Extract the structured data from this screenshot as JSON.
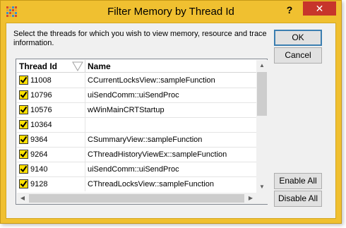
{
  "window": {
    "title": "Filter Memory by Thread Id",
    "help_label": "?",
    "close_label": "✕",
    "colors": {
      "frame": "#f0c030",
      "close": "#c7352b",
      "checkbox": "#ffe000"
    }
  },
  "instructions": "Select the threads for which you wish to view memory, resource and trace information.",
  "buttons": {
    "ok": "OK",
    "cancel": "Cancel",
    "enable_all": "Enable All",
    "disable_all": "Disable All"
  },
  "table": {
    "columns": [
      "Thread Id",
      "Name"
    ],
    "sort_icon": "sort-descending-icon",
    "rows": [
      {
        "checked": true,
        "thread_id": "11008",
        "name": "CCurrentLocksView::sampleFunction"
      },
      {
        "checked": true,
        "thread_id": "10796",
        "name": "uiSendComm::uiSendProc"
      },
      {
        "checked": true,
        "thread_id": "10576",
        "name": "wWinMainCRTStartup"
      },
      {
        "checked": true,
        "thread_id": "10364",
        "name": ""
      },
      {
        "checked": true,
        "thread_id": "9364",
        "name": "CSummaryView::sampleFunction"
      },
      {
        "checked": true,
        "thread_id": "9264",
        "name": "CThreadHistoryViewEx::sampleFunction"
      },
      {
        "checked": true,
        "thread_id": "9140",
        "name": "uiSendComm::uiSendProc"
      },
      {
        "checked": true,
        "thread_id": "9128",
        "name": "CThreadLocksView::sampleFunction"
      }
    ]
  }
}
